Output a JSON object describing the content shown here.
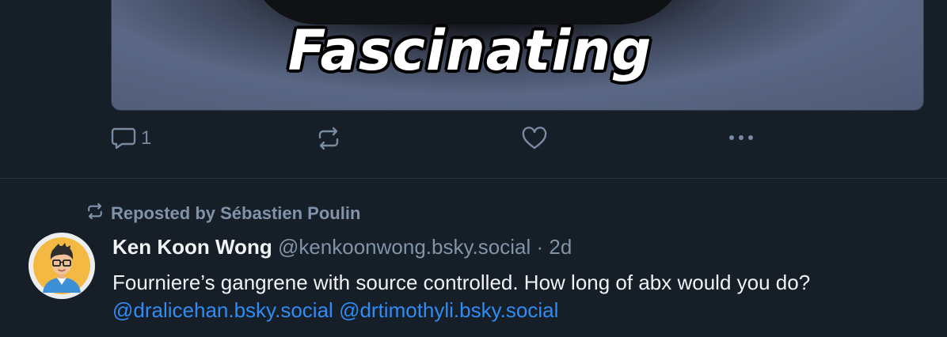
{
  "first_post": {
    "media": {
      "caption": "Fascinating"
    },
    "actions": {
      "reply_icon": "comment-icon",
      "reply_count": "1",
      "repost_icon": "repost-icon",
      "like_icon": "heart-icon",
      "more_icon": "ellipsis-icon"
    }
  },
  "second_post": {
    "repost_banner": {
      "icon": "repost-icon",
      "label": "Reposted by Sébastien Poulin"
    },
    "author": {
      "avatar_icon": "cartoon-avatar-glasses",
      "name": "Ken Koon Wong",
      "handle": "@kenkoonwong.bsky.social",
      "separator": " · ",
      "age": "2d"
    },
    "body": {
      "text": "Fourniere’s gangrene with source controlled. How long of abx would you do? ",
      "mentions": [
        "@dralicehan.bsky.social",
        "@drtimothyli.bsky.social"
      ]
    }
  },
  "colors": {
    "background": "#161e27",
    "muted_text": "#8193a8",
    "link": "#2f8cf5",
    "divider": "#2b3644"
  }
}
